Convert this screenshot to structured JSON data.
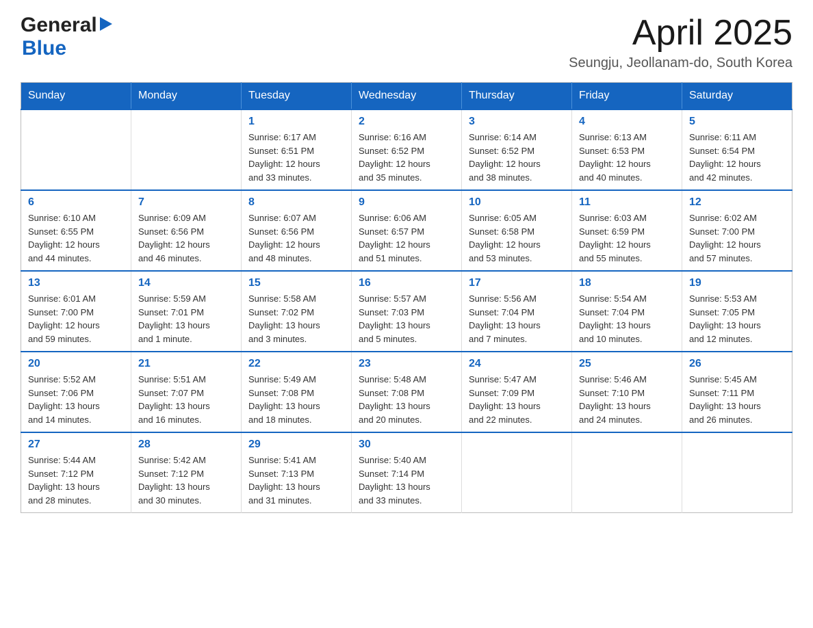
{
  "logo": {
    "general": "General",
    "blue": "Blue"
  },
  "header": {
    "month": "April 2025",
    "location": "Seungju, Jeollanam-do, South Korea"
  },
  "weekdays": [
    "Sunday",
    "Monday",
    "Tuesday",
    "Wednesday",
    "Thursday",
    "Friday",
    "Saturday"
  ],
  "weeks": [
    [
      {
        "day": "",
        "info": ""
      },
      {
        "day": "",
        "info": ""
      },
      {
        "day": "1",
        "info": "Sunrise: 6:17 AM\nSunset: 6:51 PM\nDaylight: 12 hours\nand 33 minutes."
      },
      {
        "day": "2",
        "info": "Sunrise: 6:16 AM\nSunset: 6:52 PM\nDaylight: 12 hours\nand 35 minutes."
      },
      {
        "day": "3",
        "info": "Sunrise: 6:14 AM\nSunset: 6:52 PM\nDaylight: 12 hours\nand 38 minutes."
      },
      {
        "day": "4",
        "info": "Sunrise: 6:13 AM\nSunset: 6:53 PM\nDaylight: 12 hours\nand 40 minutes."
      },
      {
        "day": "5",
        "info": "Sunrise: 6:11 AM\nSunset: 6:54 PM\nDaylight: 12 hours\nand 42 minutes."
      }
    ],
    [
      {
        "day": "6",
        "info": "Sunrise: 6:10 AM\nSunset: 6:55 PM\nDaylight: 12 hours\nand 44 minutes."
      },
      {
        "day": "7",
        "info": "Sunrise: 6:09 AM\nSunset: 6:56 PM\nDaylight: 12 hours\nand 46 minutes."
      },
      {
        "day": "8",
        "info": "Sunrise: 6:07 AM\nSunset: 6:56 PM\nDaylight: 12 hours\nand 48 minutes."
      },
      {
        "day": "9",
        "info": "Sunrise: 6:06 AM\nSunset: 6:57 PM\nDaylight: 12 hours\nand 51 minutes."
      },
      {
        "day": "10",
        "info": "Sunrise: 6:05 AM\nSunset: 6:58 PM\nDaylight: 12 hours\nand 53 minutes."
      },
      {
        "day": "11",
        "info": "Sunrise: 6:03 AM\nSunset: 6:59 PM\nDaylight: 12 hours\nand 55 minutes."
      },
      {
        "day": "12",
        "info": "Sunrise: 6:02 AM\nSunset: 7:00 PM\nDaylight: 12 hours\nand 57 minutes."
      }
    ],
    [
      {
        "day": "13",
        "info": "Sunrise: 6:01 AM\nSunset: 7:00 PM\nDaylight: 12 hours\nand 59 minutes."
      },
      {
        "day": "14",
        "info": "Sunrise: 5:59 AM\nSunset: 7:01 PM\nDaylight: 13 hours\nand 1 minute."
      },
      {
        "day": "15",
        "info": "Sunrise: 5:58 AM\nSunset: 7:02 PM\nDaylight: 13 hours\nand 3 minutes."
      },
      {
        "day": "16",
        "info": "Sunrise: 5:57 AM\nSunset: 7:03 PM\nDaylight: 13 hours\nand 5 minutes."
      },
      {
        "day": "17",
        "info": "Sunrise: 5:56 AM\nSunset: 7:04 PM\nDaylight: 13 hours\nand 7 minutes."
      },
      {
        "day": "18",
        "info": "Sunrise: 5:54 AM\nSunset: 7:04 PM\nDaylight: 13 hours\nand 10 minutes."
      },
      {
        "day": "19",
        "info": "Sunrise: 5:53 AM\nSunset: 7:05 PM\nDaylight: 13 hours\nand 12 minutes."
      }
    ],
    [
      {
        "day": "20",
        "info": "Sunrise: 5:52 AM\nSunset: 7:06 PM\nDaylight: 13 hours\nand 14 minutes."
      },
      {
        "day": "21",
        "info": "Sunrise: 5:51 AM\nSunset: 7:07 PM\nDaylight: 13 hours\nand 16 minutes."
      },
      {
        "day": "22",
        "info": "Sunrise: 5:49 AM\nSunset: 7:08 PM\nDaylight: 13 hours\nand 18 minutes."
      },
      {
        "day": "23",
        "info": "Sunrise: 5:48 AM\nSunset: 7:08 PM\nDaylight: 13 hours\nand 20 minutes."
      },
      {
        "day": "24",
        "info": "Sunrise: 5:47 AM\nSunset: 7:09 PM\nDaylight: 13 hours\nand 22 minutes."
      },
      {
        "day": "25",
        "info": "Sunrise: 5:46 AM\nSunset: 7:10 PM\nDaylight: 13 hours\nand 24 minutes."
      },
      {
        "day": "26",
        "info": "Sunrise: 5:45 AM\nSunset: 7:11 PM\nDaylight: 13 hours\nand 26 minutes."
      }
    ],
    [
      {
        "day": "27",
        "info": "Sunrise: 5:44 AM\nSunset: 7:12 PM\nDaylight: 13 hours\nand 28 minutes."
      },
      {
        "day": "28",
        "info": "Sunrise: 5:42 AM\nSunset: 7:12 PM\nDaylight: 13 hours\nand 30 minutes."
      },
      {
        "day": "29",
        "info": "Sunrise: 5:41 AM\nSunset: 7:13 PM\nDaylight: 13 hours\nand 31 minutes."
      },
      {
        "day": "30",
        "info": "Sunrise: 5:40 AM\nSunset: 7:14 PM\nDaylight: 13 hours\nand 33 minutes."
      },
      {
        "day": "",
        "info": ""
      },
      {
        "day": "",
        "info": ""
      },
      {
        "day": "",
        "info": ""
      }
    ]
  ]
}
